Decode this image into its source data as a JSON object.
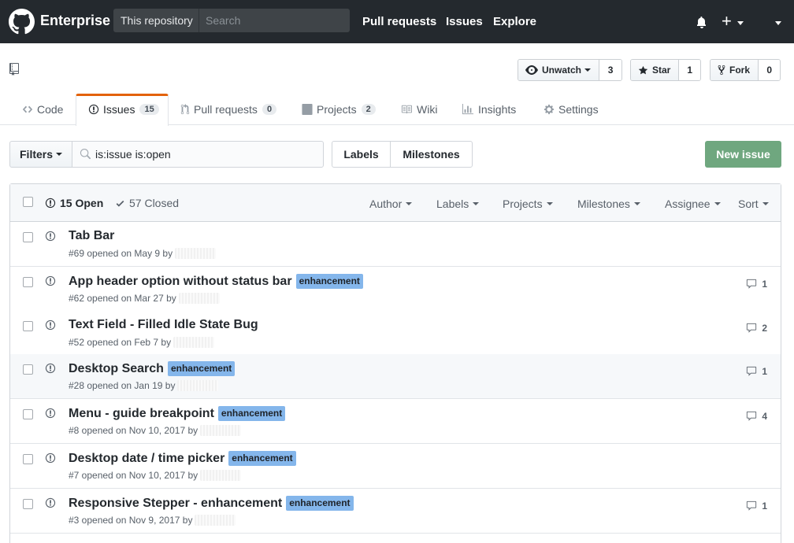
{
  "header": {
    "brand": "Enterprise",
    "scope": "This repository",
    "search_placeholder": "Search",
    "nav": [
      "Pull requests",
      "Issues",
      "Explore"
    ]
  },
  "repo_actions": {
    "watch": {
      "label": "Unwatch",
      "count": "3"
    },
    "star": {
      "label": "Star",
      "count": "1"
    },
    "fork": {
      "label": "Fork",
      "count": "0"
    }
  },
  "tabs": [
    {
      "label": "Code",
      "icon": "code-icon"
    },
    {
      "label": "Issues",
      "count": "15",
      "icon": "issue-opened-icon",
      "selected": true
    },
    {
      "label": "Pull requests",
      "count": "0",
      "icon": "git-pull-request-icon"
    },
    {
      "label": "Projects",
      "count": "2",
      "icon": "project-icon"
    },
    {
      "label": "Wiki",
      "icon": "book-icon"
    },
    {
      "label": "Insights",
      "icon": "graph-icon"
    },
    {
      "label": "Settings",
      "icon": "gear-icon"
    }
  ],
  "filter_bar": {
    "filters_label": "Filters",
    "query": "is:issue is:open",
    "labels_label": "Labels",
    "milestones_label": "Milestones",
    "new_issue_label": "New issue"
  },
  "issues_header": {
    "open": "15 Open",
    "closed": "57 Closed",
    "menus": [
      "Author",
      "Labels",
      "Projects",
      "Milestones",
      "Assignee",
      "Sort"
    ]
  },
  "issues": [
    {
      "title": "Tab Bar",
      "label": "",
      "meta": "#69 opened on May 9 by",
      "comments": ""
    },
    {
      "title": "App header option without status bar",
      "label": "enhancement",
      "meta": "#62 opened on Mar 27 by",
      "comments": "1"
    },
    {
      "title": "Text Field - Filled Idle State Bug",
      "label": "",
      "meta": "#52 opened on Feb 7 by",
      "comments": "2"
    },
    {
      "title": "Desktop Search",
      "label": "enhancement",
      "meta": "#28 opened on Jan 19 by",
      "comments": "1"
    },
    {
      "title": "Menu - guide breakpoint",
      "label": "enhancement",
      "meta": "#8 opened on Nov 10, 2017 by",
      "comments": "4"
    },
    {
      "title": "Desktop date / time picker",
      "label": "enhancement",
      "meta": "#7 opened on Nov 10, 2017 by",
      "comments": ""
    },
    {
      "title": "Responsive Stepper - enhancement",
      "label": "enhancement",
      "meta": "#3 opened on Nov 9, 2017 by",
      "comments": "1"
    }
  ],
  "colors": {
    "header_bg": "#24292e",
    "selected_tab_accent": "#e36209",
    "new_issue_bg": "#6fa77f",
    "enhancement_label": "#84b6eb",
    "open_icon": "#586069"
  }
}
